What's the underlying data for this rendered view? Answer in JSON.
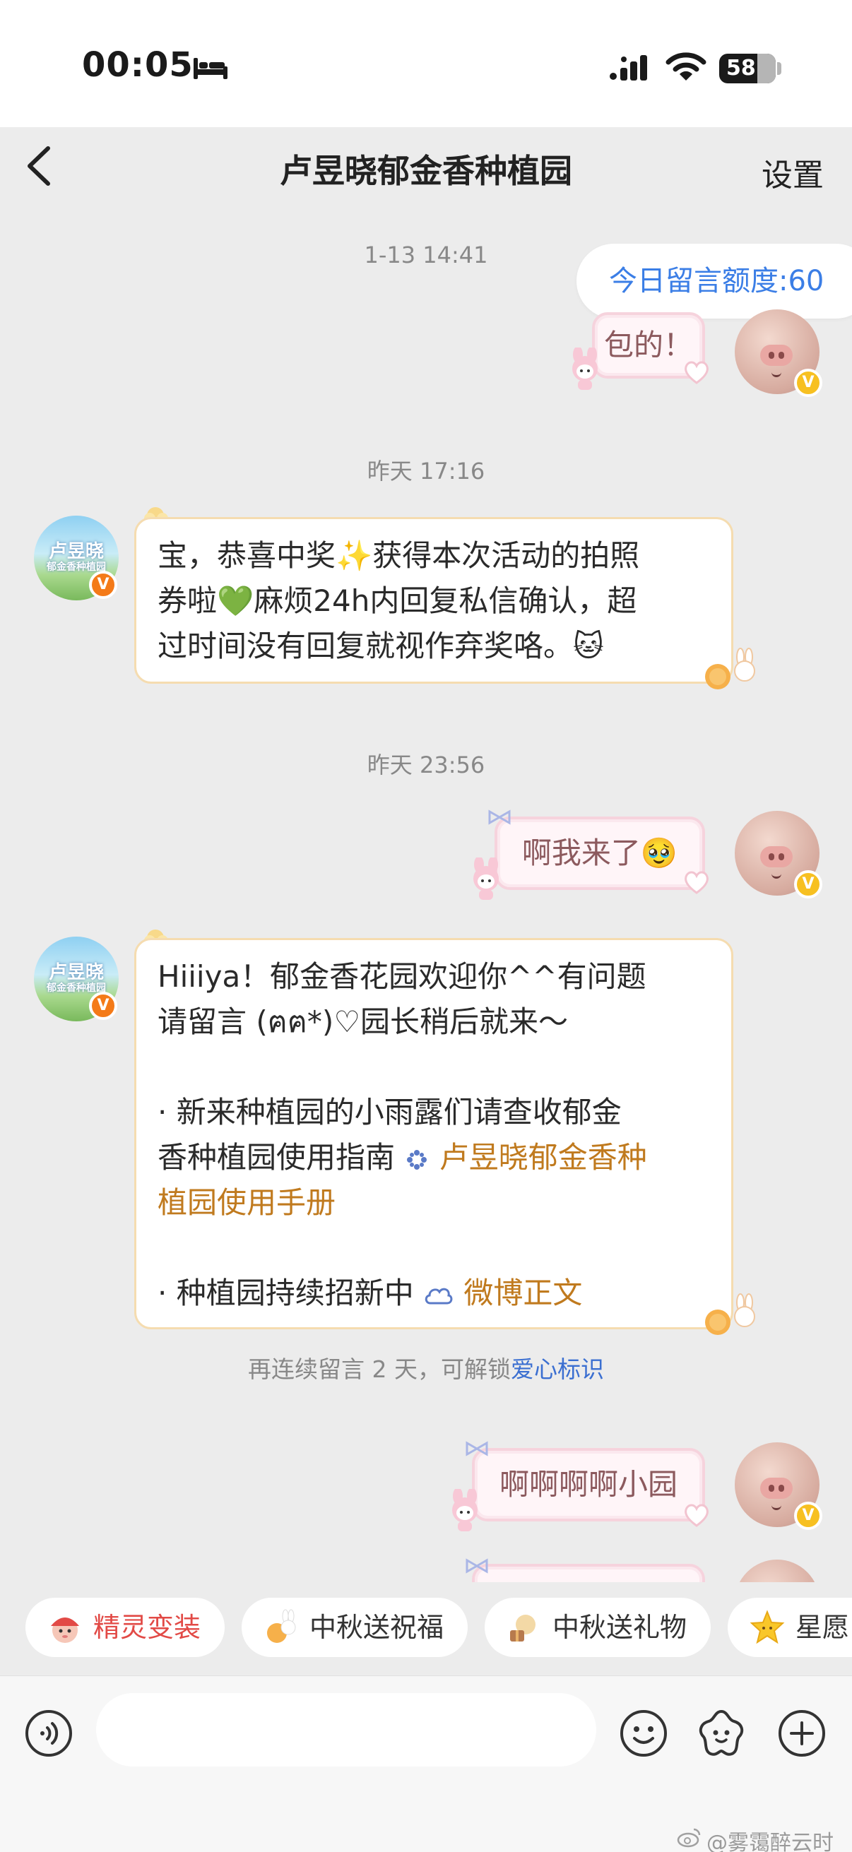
{
  "status_bar": {
    "time": "00:05",
    "battery": "58"
  },
  "nav": {
    "title": "卢昱晓郁金香种植园",
    "settings": "设置"
  },
  "chat": {
    "quota": "今日留言额度:60",
    "messages": [
      {
        "type": "timestamp",
        "text": "1-13 14:41"
      },
      {
        "type": "outgoing",
        "text": "包的！"
      },
      {
        "type": "timestamp",
        "text": "昨天 17:16"
      },
      {
        "type": "incoming",
        "lines": [
          "宝，恭喜中奖✨获得本次活动的拍照",
          "券啦💚麻烦24h内回复私信确认，超",
          "过时间没有回复就视作弃奖咯。🐱"
        ]
      },
      {
        "type": "timestamp",
        "text": "昨天 23:56"
      },
      {
        "type": "outgoing",
        "text": "啊我来了🥹"
      },
      {
        "type": "incoming",
        "line1": "Hiiiya！郁金香花园欢迎你^^有问题",
        "line2": "请留言 (ฅฅ*)♡园长稍后就来～",
        "line3": "· 新来种植园的小雨露们请查收郁金",
        "line4_prefix": "香种植园使用指南",
        "line4_link": "卢昱晓郁金香种",
        "line5_link": "植园使用手册",
        "line6_prefix": "· 种植园持续招新中",
        "line6_link": "微博正文"
      },
      {
        "type": "notice",
        "prefix": "再连续留言 2 天，可解锁",
        "highlight": "爱心标识"
      },
      {
        "type": "outgoing",
        "text": "啊啊啊啊小园"
      }
    ],
    "garden_avatar_title": "卢昱晓",
    "garden_avatar_subtitle": "郁金香种植园",
    "verified_mark": "V"
  },
  "quick_actions": [
    {
      "label": "精灵变装"
    },
    {
      "label": "中秋送祝福"
    },
    {
      "label": "中秋送礼物"
    },
    {
      "label": "星愿"
    }
  ],
  "watermark": "@雾霭醉云时",
  "colors": {
    "link_blue": "#3b7ee6",
    "link_orange": "#c07a1e",
    "badge_orange": "#f47a18",
    "badge_yellow": "#f7c021"
  }
}
